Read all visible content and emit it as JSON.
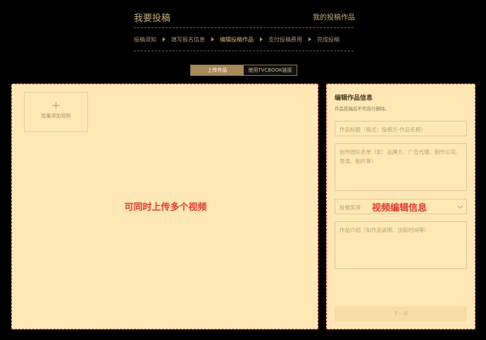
{
  "header": {
    "title": "我要投稿",
    "my_works_link": "我的投稿作品"
  },
  "steps": [
    {
      "label": "投稿须知",
      "active": false
    },
    {
      "label": "填写报名信息",
      "active": false
    },
    {
      "label": "编辑投稿作品",
      "active": true
    },
    {
      "label": "支付投稿费用",
      "active": false
    },
    {
      "label": "完成投稿",
      "active": false
    }
  ],
  "tabs": {
    "upload": "上传作品",
    "tvcbook": "使用TVCBOOK链接"
  },
  "upload_panel": {
    "add_label": "批量添加视频",
    "add_icon": "+",
    "annotation": "可同时上传多个视频"
  },
  "form": {
    "title": "编辑作品信息",
    "subtitle": "作品投稿后不可自行删除。",
    "title_placeholder": "作品标题（格式：投稿方-作品名称）",
    "team_placeholder": "创作团队名单（如：品牌方、广告代理、制作公司、导演、制片等）",
    "award_placeholder": "投报奖项",
    "intro_placeholder": "作品介绍（如作品说明、出街时间等）",
    "annotation": "视频编辑信息",
    "next_button": "下一步"
  },
  "colors": {
    "accent": "#c9ad7c",
    "panel_bg": "#ffe8b5",
    "annotation_red": "#e23b2f"
  }
}
